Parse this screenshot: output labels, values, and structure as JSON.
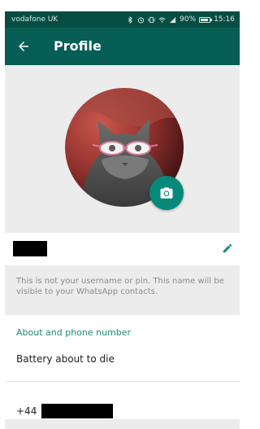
{
  "status_bar": {
    "carrier": "vodafone UK",
    "battery": "90%",
    "time": "15:16",
    "icons": [
      "bluetooth-icon",
      "alarm-icon",
      "vibrate-icon",
      "wifi-icon",
      "signal-icon",
      "battery-icon"
    ]
  },
  "header": {
    "title": "Profile",
    "back_icon": "arrow-left-icon"
  },
  "profile": {
    "photo_subject": "",
    "camera_icon": "camera-icon",
    "name_value": "",
    "edit_icon": "pencil-icon",
    "name_hint": "This is not your username or pin. This name will be visible to your WhatsApp contacts."
  },
  "about": {
    "heading": "About and phone number",
    "text": "Battery about to die",
    "phone_prefix": "+44",
    "phone_number": ""
  },
  "colors": {
    "status_bar": "#064d44",
    "app_bar": "#075e54",
    "accent": "#1a8a7a",
    "camera_fab": "#07897a",
    "background": "#ececec"
  }
}
